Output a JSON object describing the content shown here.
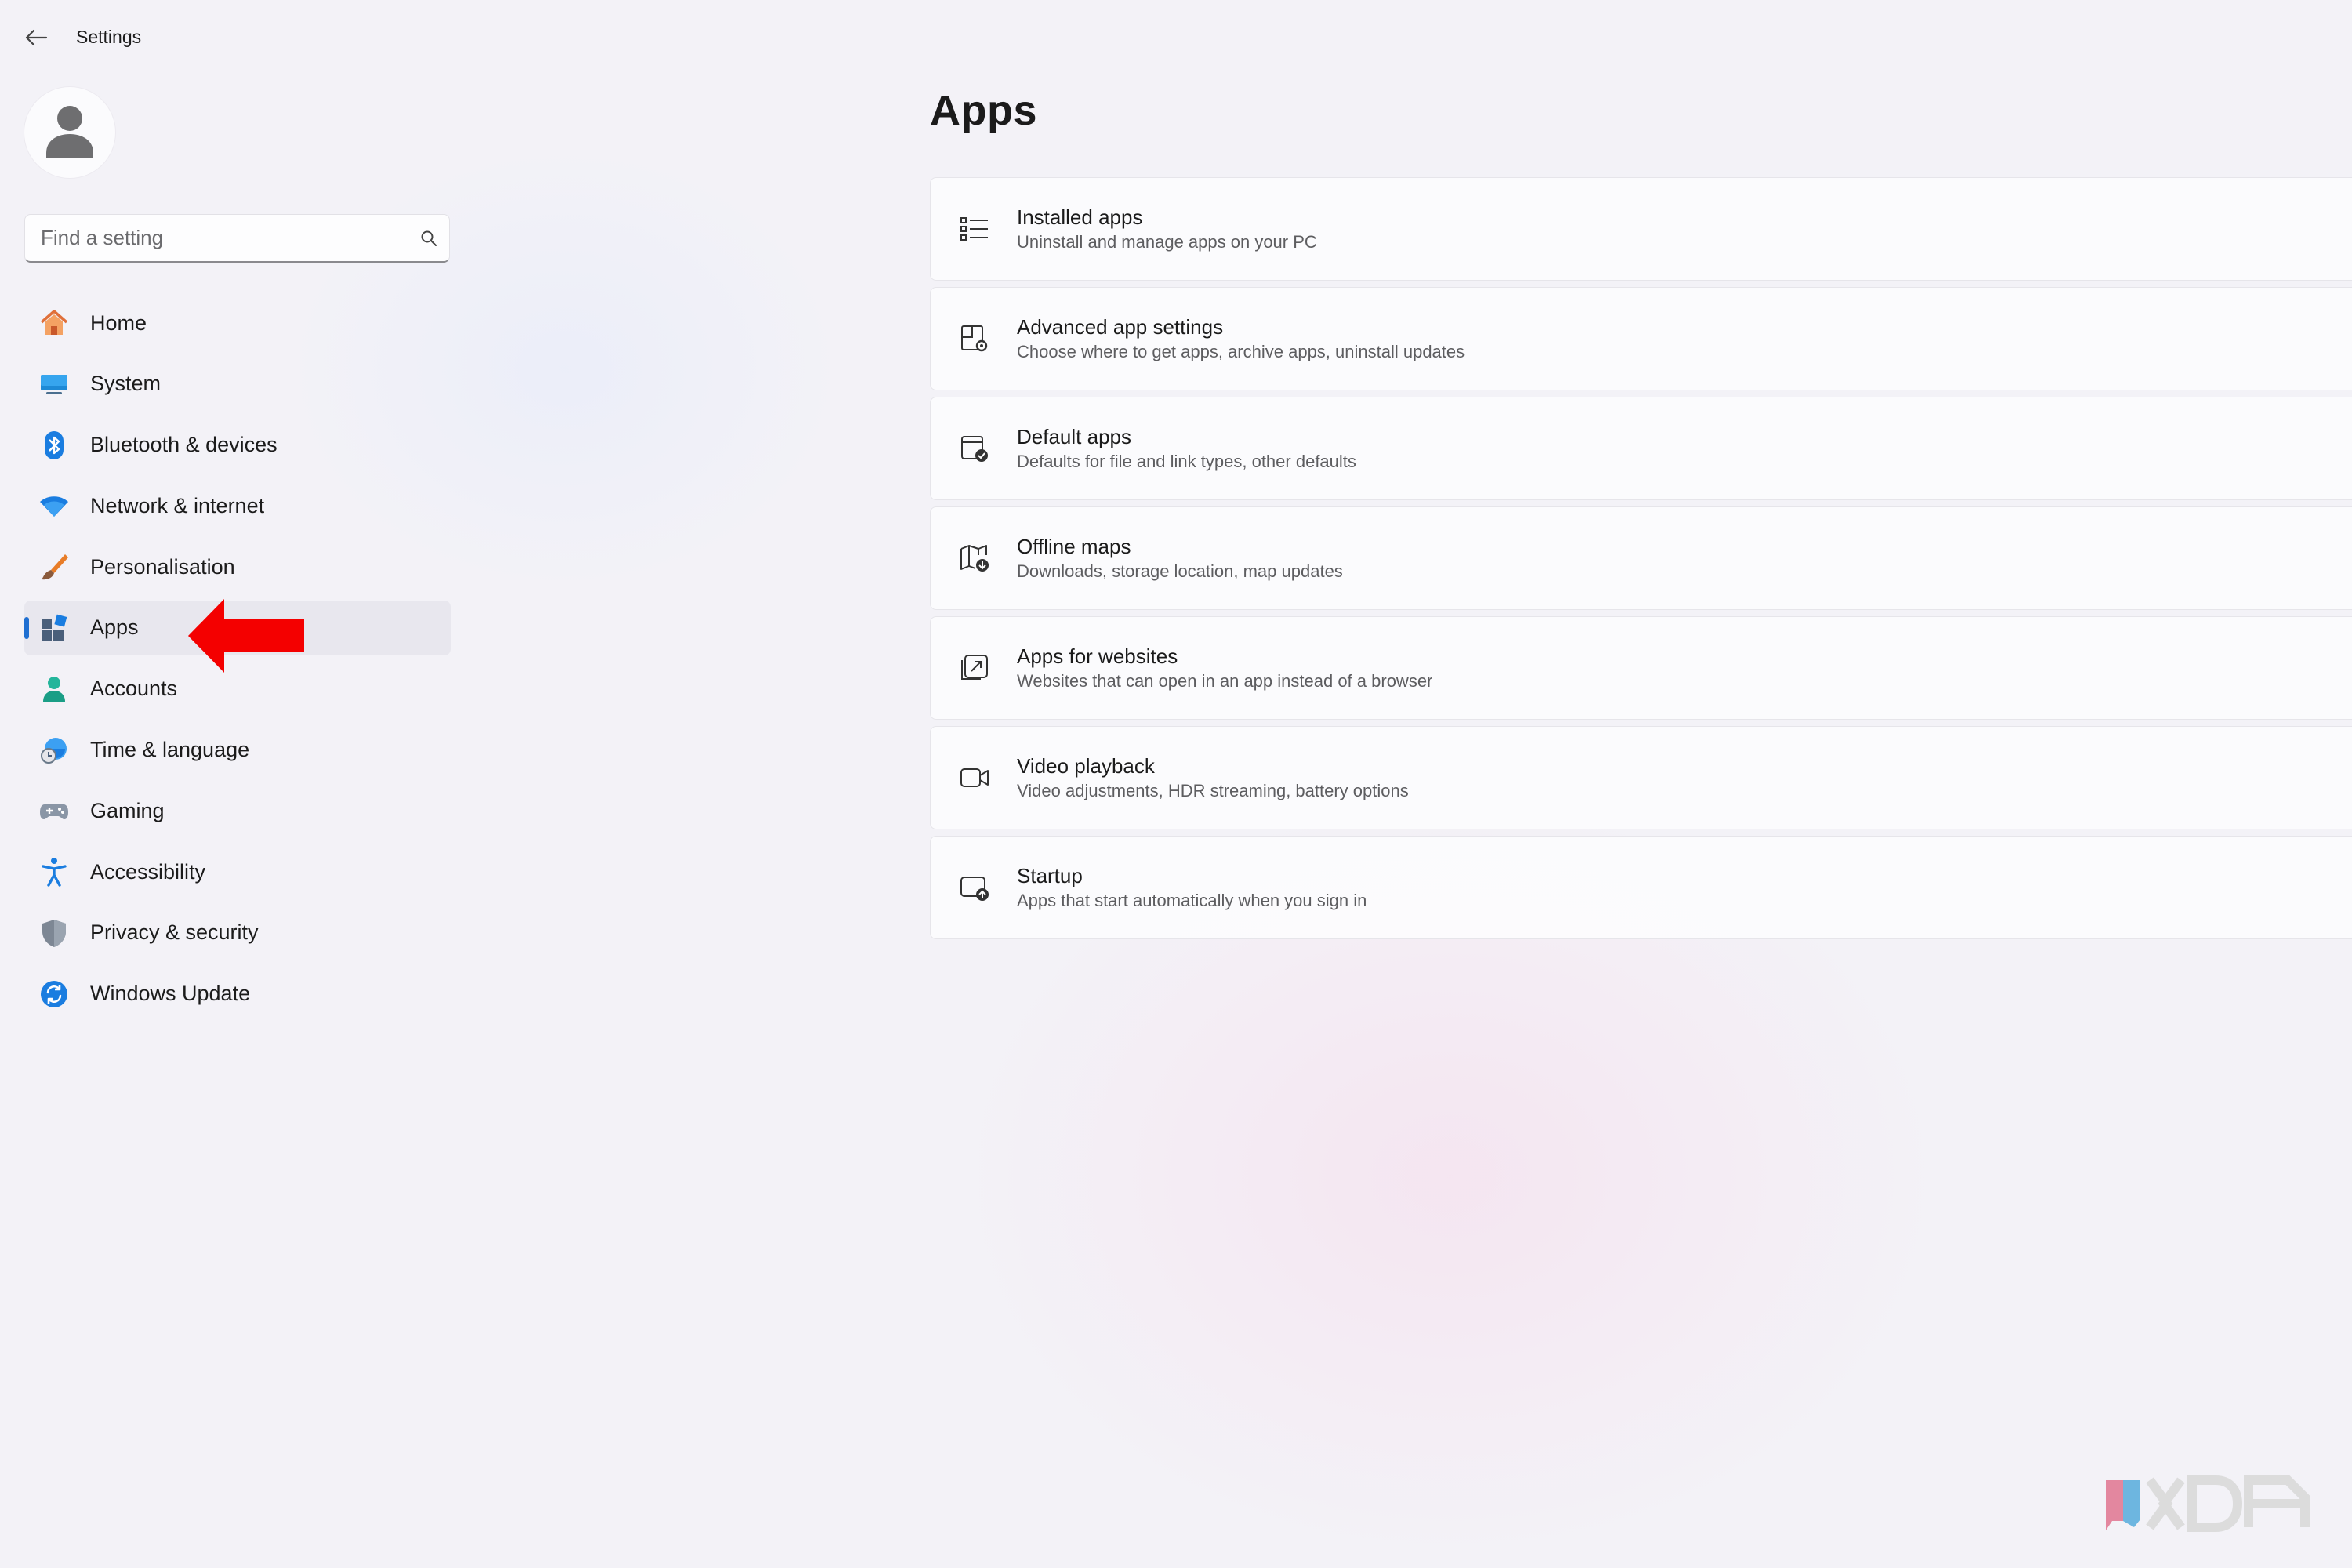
{
  "window": {
    "title": "Settings",
    "back_icon": "back-arrow-icon"
  },
  "sidebar": {
    "avatar_icon": "user-avatar-icon",
    "search": {
      "placeholder": "Find a setting",
      "icon": "search-icon"
    },
    "items": [
      {
        "label": "Home",
        "icon": "home-icon"
      },
      {
        "label": "System",
        "icon": "system-icon"
      },
      {
        "label": "Bluetooth & devices",
        "icon": "bluetooth-icon"
      },
      {
        "label": "Network & internet",
        "icon": "wifi-icon"
      },
      {
        "label": "Personalisation",
        "icon": "brush-icon"
      },
      {
        "label": "Apps",
        "icon": "apps-icon",
        "selected": true
      },
      {
        "label": "Accounts",
        "icon": "accounts-icon"
      },
      {
        "label": "Time & language",
        "icon": "time-language-icon"
      },
      {
        "label": "Gaming",
        "icon": "gamepad-icon"
      },
      {
        "label": "Accessibility",
        "icon": "accessibility-icon"
      },
      {
        "label": "Privacy & security",
        "icon": "shield-icon"
      },
      {
        "label": "Windows Update",
        "icon": "update-icon"
      }
    ],
    "annotation": {
      "icon": "red-arrow-icon",
      "color": "#ff0000"
    }
  },
  "main": {
    "title": "Apps",
    "cards": [
      {
        "title": "Installed apps",
        "description": "Uninstall and manage apps on your PC",
        "icon": "list-icon"
      },
      {
        "title": "Advanced app settings",
        "description": "Choose where to get apps, archive apps, uninstall updates",
        "icon": "app-settings-icon"
      },
      {
        "title": "Default apps",
        "description": "Defaults for file and link types, other defaults",
        "icon": "default-apps-icon"
      },
      {
        "title": "Offline maps",
        "description": "Downloads, storage location, map updates",
        "icon": "map-download-icon"
      },
      {
        "title": "Apps for websites",
        "description": "Websites that can open in an app instead of a browser",
        "icon": "open-external-icon"
      },
      {
        "title": "Video playback",
        "description": "Video adjustments, HDR streaming, battery options",
        "icon": "video-camera-icon"
      },
      {
        "title": "Startup",
        "description": "Apps that start automatically when you sign in",
        "icon": "startup-icon"
      }
    ]
  },
  "watermark": {
    "text": "XDA",
    "icon": "xda-logo-icon"
  },
  "colors": {
    "accent": "#1f6fd1",
    "background": "#f3f2f7",
    "selected_bg": "#e8e7ee"
  }
}
